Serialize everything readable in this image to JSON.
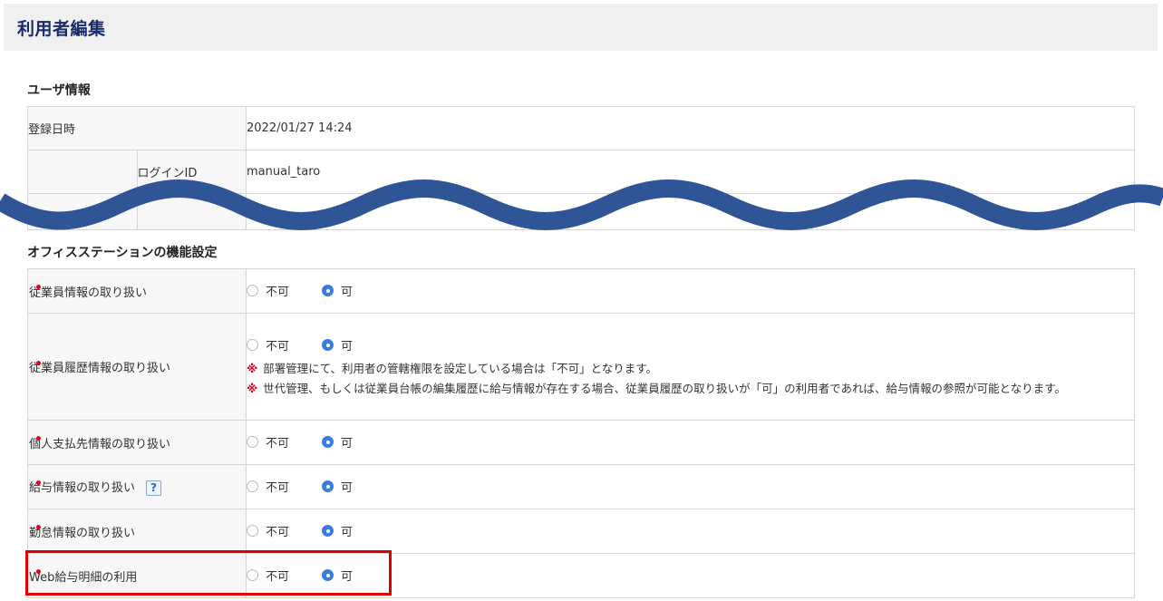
{
  "page": {
    "title": "利用者編集"
  },
  "user_info": {
    "heading": "ユーザ情報",
    "registered_label": "登録日時",
    "registered_value": "2022/01/27 14:24",
    "login_id_label": "ログインID",
    "login_id_value": "manual_taro"
  },
  "office_station": {
    "heading": "オフィスステーションの機能設定",
    "option_no": "不可",
    "option_yes": "可",
    "rows": [
      {
        "label": "従業員情報の取り扱い",
        "selected": "可"
      },
      {
        "label": "従業員履歴情報の取り扱い",
        "selected": "可",
        "notes": [
          "部署管理にて、利用者の管轄権限を設定している場合は「不可」となります。",
          "世代管理、もしくは従業員台帳の編集履歴に給与情報が存在する場合、従業員履歴の取り扱いが「可」の利用者であれば、給与情報の参照が可能となります。"
        ]
      },
      {
        "label": "個人支払先情報の取り扱い",
        "selected": "可"
      },
      {
        "label": "給与情報の取り扱い",
        "selected": "可",
        "help_icon": "?"
      },
      {
        "label": "勤怠情報の取り扱い",
        "selected": "可"
      },
      {
        "label": "Web給与明細の利用",
        "selected": "可"
      }
    ],
    "note_mark": "※",
    "required_mark": "•"
  },
  "colors": {
    "required": "#e0001a",
    "radio_checked": "#3a7ddc",
    "wave": "#2f5597",
    "highlight": "#e00000",
    "title": "#1a2a6c"
  }
}
